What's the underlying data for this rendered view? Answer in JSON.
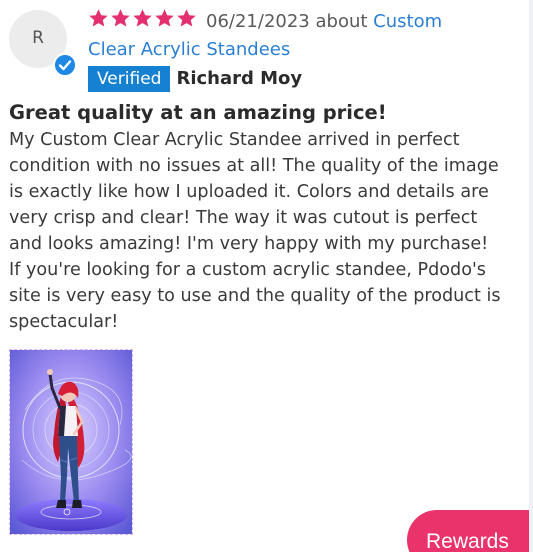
{
  "review": {
    "avatar_initial": "R",
    "rating": 5,
    "date": "06/21/2023",
    "about_label": "about",
    "product_name_line1": "Custom",
    "product_name_line2": "Clear Acrylic Standees",
    "verified_label": "Verified",
    "author": "Richard Moy",
    "title": "Great quality at an amazing price!",
    "body": "My Custom Clear Acrylic Standee arrived in perfect condition with no issues at all! The quality of the image is exactly like how I uploaded it. Colors and details are very crisp and clear! The way it was cutout is perfect and looks amazing! I'm very happy with my purchase! If you're looking for a custom acrylic standee, Pdodo's site is very easy to use and the quality of the product is spectacular!"
  },
  "rewards_button": {
    "label": "Rewards"
  },
  "colors": {
    "star": "#e4306f",
    "link": "#2a7fd4",
    "verified_badge": "#1581d0",
    "rewards": "#e9336a"
  },
  "icons": {
    "star": "star-icon",
    "verified": "check-circle-icon"
  }
}
